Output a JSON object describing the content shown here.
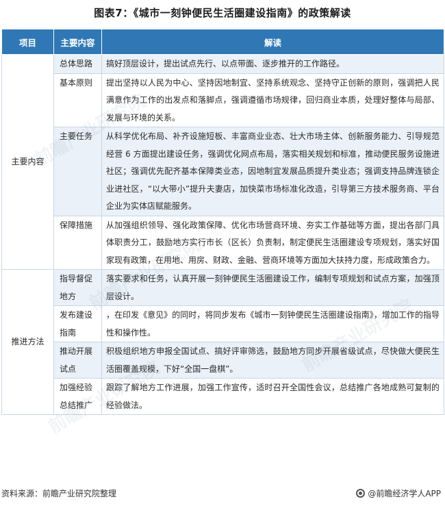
{
  "title": "图表7：《城市一刻钟便民生活圈建设指南》的政策解读",
  "table": {
    "headers": [
      "项目",
      "主要内容",
      "解读"
    ],
    "groups": [
      {
        "category": "主要内容",
        "rows": [
          {
            "item": "总体思路",
            "text": "搞好顶层设计，提出试点先行、以点带面、逐步推开的工作路径。"
          },
          {
            "item": "基本原则",
            "text": "提出坚持以人民为中心、坚持因地制宜、坚持系统观念、坚持守正创新的原则，强调把人民满意作为工作的出发点和落脚点，强调遵循市场规律，回归商业本质，处理好整体与局部、发展与环境的关系。"
          },
          {
            "item": "主要任务",
            "text": "从科学优化布局、补齐设施短板、丰富商业业态、壮大市场主体、创新服务能力、引导规范经营 6 方面提出建设任务，强调优化网点布局，落实相关规划和标准，推动便民服务设施进社区；强调优先配齐基本保障类业态，因地制宜发展品质提升类业态；强调支持品牌连锁企业进社区，“以大带小”提升夫妻店，加快菜市场标准化改造，引导第三方技术服务商、平台企业为实体店赋能服务。"
          },
          {
            "item": "保障措施",
            "text": "从加强组织领导、强化政策保障、优化市场营商环境、夯实工作基础等方面，提出各部门具体职责分工，鼓励地方实行市长（区长）负责制，制定便民生活圈建设专项规划，落实好国家现有政策，在用地、用房、财政、金融、营商环境等方面加大扶持力度，形成政策合力。"
          }
        ]
      },
      {
        "category": "推进方法",
        "rows": [
          {
            "item": "指导督促地方",
            "text": "落实要求和任务，认真开展一刻钟便民生活圈建设工作，编制专项规划和试点方案，加强顶层设计。"
          },
          {
            "item": "发布建设指南",
            "text": "，在印发《意见》的同时，将同步发布《城市一刻钟便民生活圈建设指南》，增加工作的指导性和操作性。"
          },
          {
            "item": "推动开展试点",
            "text": "积极组织地方申报全国试点、搞好评审筛选，鼓励地方同步开展省级试点，尽快做大便民生活圈覆盖规模，下好“全国一盘棋”。"
          },
          {
            "item": "加强经验总结推广",
            "text": "跟踪了解地方工作进展，加强工作宣传，适时召开全国性会议，总结推广各地成熟可复制的经验做法。"
          }
        ]
      }
    ]
  },
  "footer": {
    "source": "资料来源：前瞻产业研究院整理",
    "brand": "@前瞻经济学人APP"
  },
  "watermark": "前瞻产业研究院",
  "colors": {
    "header_bg": "#2f78b5",
    "row_alt_bg": "#eaf1f8",
    "border": "#c9d6e4"
  }
}
